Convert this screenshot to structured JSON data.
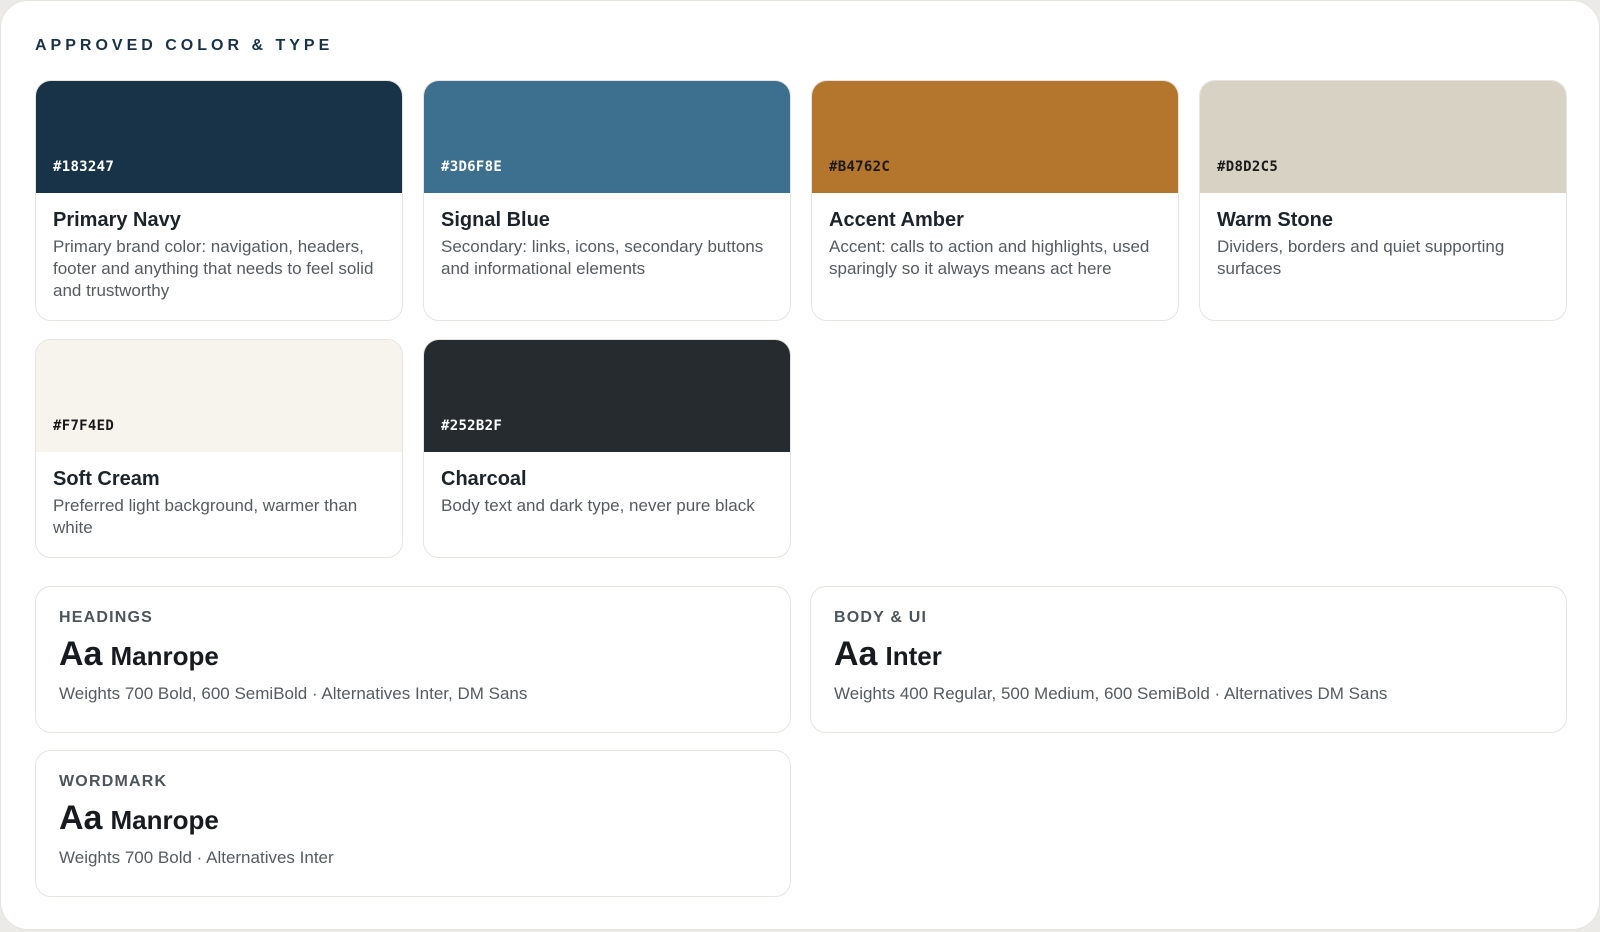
{
  "section": {
    "title": "APPROVED COLOR & TYPE"
  },
  "colors": [
    {
      "hex": "#183247",
      "name": "Primary Navy",
      "description": "Primary brand color: navigation, headers, footer and anything that needs to feel solid and trustworthy",
      "label_color": "#ffffff"
    },
    {
      "hex": "#3D6F8E",
      "name": "Signal Blue",
      "description": "Secondary: links, icons, secondary buttons and informational elements",
      "label_color": "#ffffff"
    },
    {
      "hex": "#B4762C",
      "name": "Accent Amber",
      "description": "Accent: calls to action and highlights, used sparingly so it always means act here",
      "label_color": "#1a1a1a"
    },
    {
      "hex": "#D8D2C5",
      "name": "Warm Stone",
      "description": "Dividers, borders and quiet supporting surfaces",
      "label_color": "#1a1a1a"
    },
    {
      "hex": "#F7F4ED",
      "name": "Soft Cream",
      "description": "Preferred light background, warmer than white",
      "label_color": "#1a1a1a"
    },
    {
      "hex": "#252B2F",
      "name": "Charcoal",
      "description": "Body text and dark type, never pure black",
      "label_color": "#ffffff"
    }
  ],
  "typography": [
    {
      "label": "HEADINGS",
      "sample": "Aa",
      "font": "Manrope",
      "meta": "Weights 700 Bold, 600 SemiBold · Alternatives Inter, DM Sans"
    },
    {
      "label": "BODY & UI",
      "sample": "Aa",
      "font": "Inter",
      "meta": "Weights 400 Regular, 500 Medium, 600 SemiBold · Alternatives DM Sans"
    },
    {
      "label": "WORDMARK",
      "sample": "Aa",
      "font": "Manrope",
      "meta": "Weights 700 Bold · Alternatives Inter"
    }
  ]
}
